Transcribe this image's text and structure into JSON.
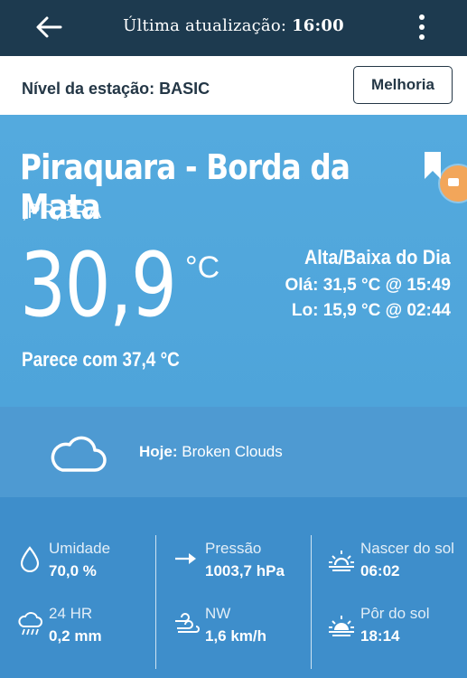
{
  "header": {
    "update_label": "Última atualização:",
    "update_time": "16:00"
  },
  "station": {
    "level_label": "Nível da estação: BASIC",
    "upgrade_label": "Melhoria"
  },
  "location": {
    "name": "Piraquara - Borda da Mata",
    "region": ",PR,BRA"
  },
  "current": {
    "temperature": "30,9",
    "unit": "°C",
    "feels_like": "Parece com 37,4 °C"
  },
  "hilo": {
    "title": "Alta/Baixa do Dia",
    "high": "Olá: 31,5 °C @ 15:49",
    "low": "Lo: 15,9 °C @ 02:44"
  },
  "forecast": {
    "label": "Hoje:",
    "condition": "Broken Clouds",
    "icon": "cloud-icon"
  },
  "stats": [
    {
      "label": "Umidade",
      "value": "70,0 %",
      "icon": "humidity-drop-icon"
    },
    {
      "label": "Pressão",
      "value": "1003,7 hPa",
      "icon": "pressure-arrow-icon"
    },
    {
      "label": "Nascer do sol",
      "value": "06:02",
      "icon": "sunrise-icon"
    },
    {
      "label": "24 HR",
      "value": "0,2 mm",
      "icon": "rain-cloud-icon"
    },
    {
      "label": "NW",
      "value": "1,6 km/h",
      "icon": "wind-icon"
    },
    {
      "label": "Pôr do sol",
      "value": "18:14",
      "icon": "sunset-icon"
    }
  ],
  "colors": {
    "topbar": "#1d3a4f",
    "hero": "#54aade",
    "forecast_band": "#4e9ad2",
    "stats_band": "#3e8ecb"
  }
}
